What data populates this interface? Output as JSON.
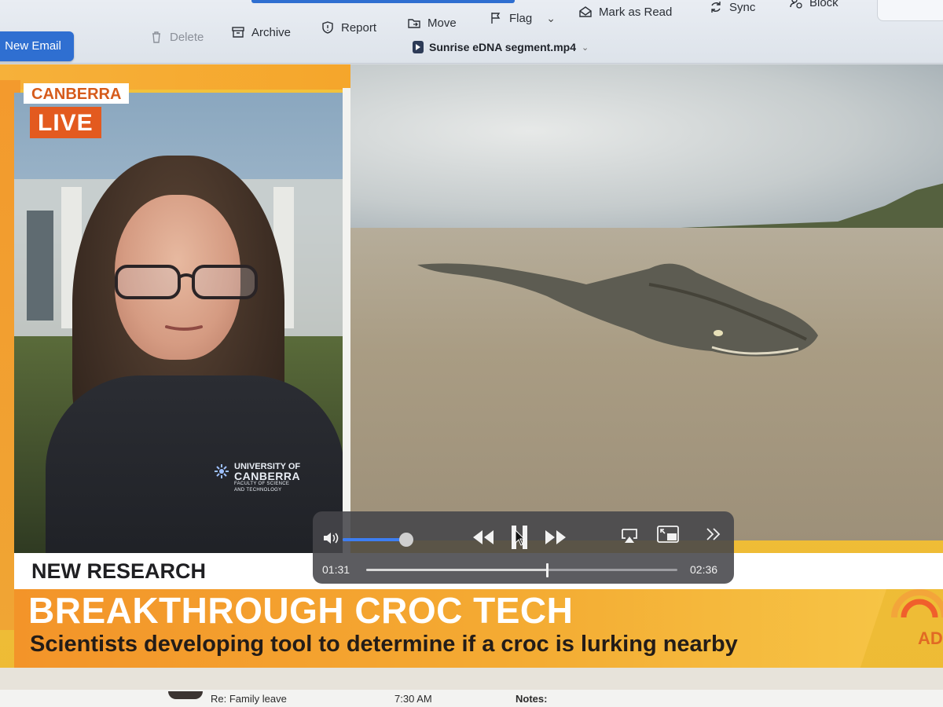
{
  "toolbar": {
    "new_email": "New Email",
    "delete": "Delete",
    "archive": "Archive",
    "report": "Report",
    "move": "Move",
    "flag": "Flag",
    "mark_as_read": "Mark as Read",
    "sync": "Sync",
    "block": "Block"
  },
  "player_window": {
    "title": "Sunrise eDNA segment.mp4"
  },
  "broadcast": {
    "location": "CANBERRA",
    "live": "LIVE",
    "kicker": "NEW RESEARCH",
    "headline": "BREAKTHROUGH CROC TECH",
    "subline": "Scientists developing tool to determine if a croc is lurking nearby",
    "network_tag": "AD",
    "jacket_logo": {
      "line1": "UNIVERSITY OF",
      "line2": "CANBERRA",
      "line3": "FACULTY OF SCIENCE",
      "line4": "AND TECHNOLOGY"
    }
  },
  "player": {
    "current_time": "01:31",
    "total_time": "02:36",
    "progress": 0.58,
    "volume": 0.9,
    "accent_color": "#3d7ef2"
  },
  "mail_list_peek": {
    "subject": "Re: Family leave",
    "time": "7:30 AM",
    "notes_label": "Notes:"
  },
  "colors": {
    "brand_blue": "#2f6fd1",
    "sunrise_orange": "#f39429",
    "live_red": "#e35a1f"
  }
}
